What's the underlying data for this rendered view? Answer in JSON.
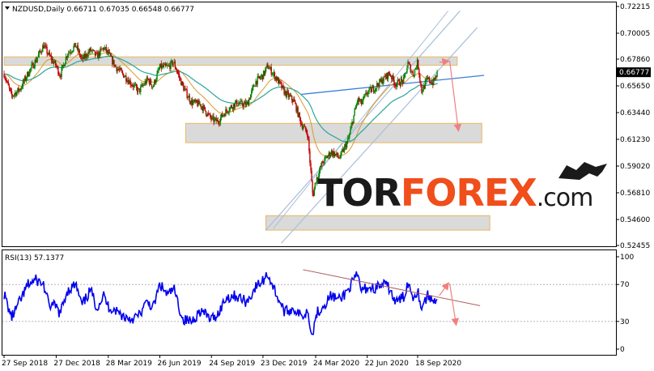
{
  "header": {
    "main_info": "NZDUSD,Daily  0.66711 0.67035 0.66548 0.66777",
    "rsi_info": "RSI(13) 57.1377"
  },
  "logo": {
    "part1": "TOR",
    "part2": "FOREX",
    "part3": ".com",
    "color_dark": "#1a1a1a",
    "color_accent": "#f04e1a"
  },
  "colors": {
    "candle": "#c00000",
    "candle_up": "#008000",
    "ema_fast": "#d69a2c",
    "ema_slow": "#2aa59a",
    "rsi_line": "#0000ee",
    "zone_fill": "#d3d3d3",
    "zone_border": "#e8b860",
    "channel": "#a9bfd6",
    "trend_blue": "#3a7fd5",
    "arrow": "#f08080",
    "rsi_trend": "#b06060",
    "current_price_bg": "#000000"
  },
  "chart_data": {
    "type": "candlestick",
    "title": "NZDUSD,Daily",
    "ohlc_last": {
      "open": 0.66711,
      "high": 0.67035,
      "low": 0.66548,
      "close": 0.66777
    },
    "current_price_label": "0.66777",
    "ylim": [
      0.52455,
      0.72215
    ],
    "price_ticks": [
      "0.72215",
      "0.70005",
      "0.67860",
      "0.65650",
      "0.63440",
      "0.61230",
      "0.59020",
      "0.56810",
      "0.54600",
      "0.52455"
    ],
    "price_tick_values": [
      0.72215,
      0.70005,
      0.6786,
      0.6565,
      0.6344,
      0.6123,
      0.5902,
      0.5681,
      0.546,
      0.52455
    ],
    "x_labels": [
      "27 Sep 2018",
      "27 Dec 2018",
      "28 Mar 2019",
      "26 Jun 2019",
      "24 Sep 2019",
      "23 Dec 2019",
      "24 Mar 2020",
      "22 Jun 2020",
      "18 Sep 2020"
    ],
    "x_label_dates": [
      "2018-09-27",
      "2018-12-27",
      "2019-03-28",
      "2019-06-26",
      "2019-09-24",
      "2019-12-23",
      "2020-03-24",
      "2020-06-22",
      "2020-09-18"
    ],
    "close_path": [
      {
        "date": "2018-09-27",
        "value": 0.6665
      },
      {
        "date": "2018-10-10",
        "value": 0.648
      },
      {
        "date": "2018-10-25",
        "value": 0.654
      },
      {
        "date": "2018-11-08",
        "value": 0.667
      },
      {
        "date": "2018-11-22",
        "value": 0.678
      },
      {
        "date": "2018-12-05",
        "value": 0.69
      },
      {
        "date": "2018-12-14",
        "value": 0.682
      },
      {
        "date": "2018-12-27",
        "value": 0.673
      },
      {
        "date": "2019-01-03",
        "value": 0.665
      },
      {
        "date": "2019-01-15",
        "value": 0.683
      },
      {
        "date": "2019-01-30",
        "value": 0.69
      },
      {
        "date": "2019-02-10",
        "value": 0.678
      },
      {
        "date": "2019-02-25",
        "value": 0.686
      },
      {
        "date": "2019-03-08",
        "value": 0.681
      },
      {
        "date": "2019-03-20",
        "value": 0.688
      },
      {
        "date": "2019-03-28",
        "value": 0.683
      },
      {
        "date": "2019-04-10",
        "value": 0.672
      },
      {
        "date": "2019-04-25",
        "value": 0.665
      },
      {
        "date": "2019-05-08",
        "value": 0.658
      },
      {
        "date": "2019-05-20",
        "value": 0.652
      },
      {
        "date": "2019-06-05",
        "value": 0.662
      },
      {
        "date": "2019-06-14",
        "value": 0.656
      },
      {
        "date": "2019-06-26",
        "value": 0.672
      },
      {
        "date": "2019-07-10",
        "value": 0.672
      },
      {
        "date": "2019-07-20",
        "value": 0.676
      },
      {
        "date": "2019-08-05",
        "value": 0.656
      },
      {
        "date": "2019-08-20",
        "value": 0.643
      },
      {
        "date": "2019-09-05",
        "value": 0.641
      },
      {
        "date": "2019-09-24",
        "value": 0.629
      },
      {
        "date": "2019-10-05",
        "value": 0.627
      },
      {
        "date": "2019-10-20",
        "value": 0.636
      },
      {
        "date": "2019-11-05",
        "value": 0.642
      },
      {
        "date": "2019-11-25",
        "value": 0.641
      },
      {
        "date": "2019-12-10",
        "value": 0.66
      },
      {
        "date": "2019-12-23",
        "value": 0.665
      },
      {
        "date": "2019-12-31",
        "value": 0.673
      },
      {
        "date": "2020-01-15",
        "value": 0.663
      },
      {
        "date": "2020-01-30",
        "value": 0.651
      },
      {
        "date": "2020-02-15",
        "value": 0.644
      },
      {
        "date": "2020-02-28",
        "value": 0.625
      },
      {
        "date": "2020-03-10",
        "value": 0.617
      },
      {
        "date": "2020-03-19",
        "value": 0.565
      },
      {
        "date": "2020-03-24",
        "value": 0.578
      },
      {
        "date": "2020-04-05",
        "value": 0.593
      },
      {
        "date": "2020-04-20",
        "value": 0.602
      },
      {
        "date": "2020-05-05",
        "value": 0.597
      },
      {
        "date": "2020-05-20",
        "value": 0.612
      },
      {
        "date": "2020-06-05",
        "value": 0.645
      },
      {
        "date": "2020-06-12",
        "value": 0.642
      },
      {
        "date": "2020-06-22",
        "value": 0.651
      },
      {
        "date": "2020-07-05",
        "value": 0.655
      },
      {
        "date": "2020-07-20",
        "value": 0.662
      },
      {
        "date": "2020-07-31",
        "value": 0.667
      },
      {
        "date": "2020-08-10",
        "value": 0.658
      },
      {
        "date": "2020-08-25",
        "value": 0.661
      },
      {
        "date": "2020-09-01",
        "value": 0.675
      },
      {
        "date": "2020-09-10",
        "value": 0.666
      },
      {
        "date": "2020-09-18",
        "value": 0.676
      },
      {
        "date": "2020-09-25",
        "value": 0.652
      },
      {
        "date": "2020-10-05",
        "value": 0.662
      },
      {
        "date": "2020-10-15",
        "value": 0.659
      },
      {
        "date": "2020-10-23",
        "value": 0.6678
      }
    ],
    "resistance_zones": [
      {
        "label": "zone-top",
        "from_date": "2018-09-27",
        "to_date": "2020-11-26",
        "low": 0.6735,
        "high": 0.6805
      },
      {
        "label": "zone-mid",
        "from_date": "2019-08-10",
        "to_date": "2021-01-08",
        "low": 0.6095,
        "high": 0.6255
      },
      {
        "label": "zone-low",
        "from_date": "2019-12-28",
        "to_date": "2021-01-22",
        "low": 0.5372,
        "high": 0.5492
      }
    ],
    "rsi": {
      "label": "RSI(13)",
      "current": 57.1377,
      "ylim": [
        0,
        100
      ],
      "ticks": [
        100,
        70,
        30,
        0
      ],
      "levels": [
        70,
        30
      ],
      "path": [
        {
          "date": "2018-09-27",
          "value": 60
        },
        {
          "date": "2018-10-10",
          "value": 34
        },
        {
          "date": "2018-10-25",
          "value": 52
        },
        {
          "date": "2018-11-08",
          "value": 70
        },
        {
          "date": "2018-11-22",
          "value": 75
        },
        {
          "date": "2018-12-05",
          "value": 70
        },
        {
          "date": "2018-12-14",
          "value": 48
        },
        {
          "date": "2018-12-27",
          "value": 46
        },
        {
          "date": "2019-01-03",
          "value": 38
        },
        {
          "date": "2019-01-15",
          "value": 63
        },
        {
          "date": "2019-01-30",
          "value": 70
        },
        {
          "date": "2019-02-10",
          "value": 47
        },
        {
          "date": "2019-02-25",
          "value": 64
        },
        {
          "date": "2019-03-08",
          "value": 45
        },
        {
          "date": "2019-03-20",
          "value": 58
        },
        {
          "date": "2019-03-28",
          "value": 46
        },
        {
          "date": "2019-04-10",
          "value": 42
        },
        {
          "date": "2019-04-25",
          "value": 35
        },
        {
          "date": "2019-05-08",
          "value": 33
        },
        {
          "date": "2019-05-20",
          "value": 36
        },
        {
          "date": "2019-06-05",
          "value": 52
        },
        {
          "date": "2019-06-14",
          "value": 44
        },
        {
          "date": "2019-06-26",
          "value": 70
        },
        {
          "date": "2019-07-10",
          "value": 58
        },
        {
          "date": "2019-07-20",
          "value": 66
        },
        {
          "date": "2019-08-05",
          "value": 32
        },
        {
          "date": "2019-08-20",
          "value": 30
        },
        {
          "date": "2019-09-05",
          "value": 42
        },
        {
          "date": "2019-09-24",
          "value": 32
        },
        {
          "date": "2019-10-05",
          "value": 38
        },
        {
          "date": "2019-10-20",
          "value": 56
        },
        {
          "date": "2019-11-05",
          "value": 58
        },
        {
          "date": "2019-11-25",
          "value": 51
        },
        {
          "date": "2019-12-10",
          "value": 67
        },
        {
          "date": "2019-12-23",
          "value": 74
        },
        {
          "date": "2019-12-31",
          "value": 82
        },
        {
          "date": "2020-01-15",
          "value": 60
        },
        {
          "date": "2020-01-30",
          "value": 40
        },
        {
          "date": "2020-02-15",
          "value": 44
        },
        {
          "date": "2020-02-28",
          "value": 35
        },
        {
          "date": "2020-03-10",
          "value": 42
        },
        {
          "date": "2020-03-19",
          "value": 13
        },
        {
          "date": "2020-03-24",
          "value": 38
        },
        {
          "date": "2020-04-05",
          "value": 46
        },
        {
          "date": "2020-04-20",
          "value": 58
        },
        {
          "date": "2020-05-05",
          "value": 53
        },
        {
          "date": "2020-05-20",
          "value": 65
        },
        {
          "date": "2020-06-05",
          "value": 80
        },
        {
          "date": "2020-06-12",
          "value": 63
        },
        {
          "date": "2020-06-22",
          "value": 67
        },
        {
          "date": "2020-07-05",
          "value": 66
        },
        {
          "date": "2020-07-20",
          "value": 70
        },
        {
          "date": "2020-07-31",
          "value": 66
        },
        {
          "date": "2020-08-10",
          "value": 50
        },
        {
          "date": "2020-08-25",
          "value": 57
        },
        {
          "date": "2020-09-01",
          "value": 72
        },
        {
          "date": "2020-09-10",
          "value": 57
        },
        {
          "date": "2020-09-18",
          "value": 64
        },
        {
          "date": "2020-09-25",
          "value": 45
        },
        {
          "date": "2020-10-05",
          "value": 58
        },
        {
          "date": "2020-10-15",
          "value": 52
        },
        {
          "date": "2020-10-23",
          "value": 57
        }
      ]
    }
  }
}
